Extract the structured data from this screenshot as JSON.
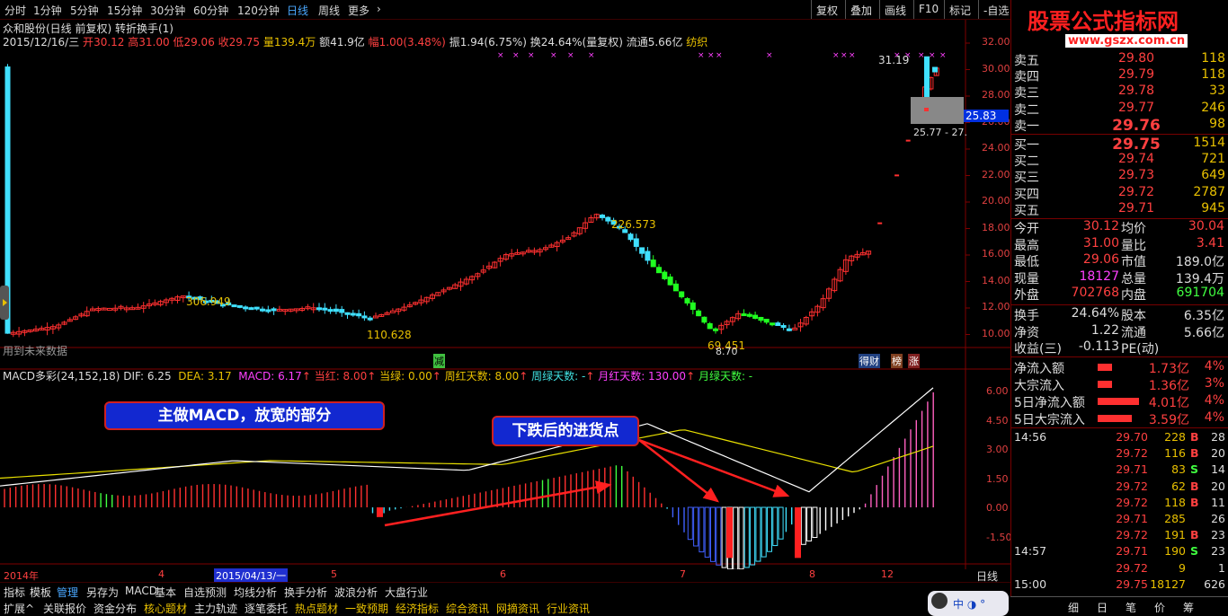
{
  "toolbar": {
    "periods": [
      "分时",
      "1分钟",
      "5分钟",
      "15分钟",
      "30分钟",
      "60分钟",
      "120分钟",
      "日线",
      "周线",
      "更多"
    ],
    "right": [
      "复权",
      "叠加",
      "画线",
      "F10",
      "标记",
      "-自选"
    ]
  },
  "header": {
    "title_line": "众和股份(日线 前复权) 转折换手(1)",
    "date": "2015/12/16/三",
    "open_lbl": "开",
    "open": "30.12",
    "high_lbl": "高",
    "high": "31.00",
    "low_lbl": "低",
    "low": "29.06",
    "close_lbl": "收",
    "close": "29.75",
    "vol_lbl": "量",
    "vol": "139.4万",
    "amt_lbl": "额",
    "amt": "41.9亿",
    "chg_lbl": "幅",
    "chg": "1.00(3.48%)",
    "amp_lbl": "振",
    "amp": "1.94(6.75%)",
    "turn_lbl": "换",
    "turn": "24.64%(量复权)",
    "float_lbl": "流通",
    "float": "5.66亿",
    "industry": "纺织"
  },
  "price_axis": [
    "32.00",
    "30.00",
    "28.00",
    "26.00",
    "24.00",
    "22.00",
    "20.00",
    "18.00",
    "16.00",
    "14.00",
    "12.00",
    "10.00"
  ],
  "price_axis_highlight": "25.83",
  "labels": {
    "hi1": "31.19",
    "range": "25.77 - 27.",
    "p1": "306.949",
    "p2": "110.628",
    "p3": "226.573",
    "p4": "69.451",
    "p5": "8.70",
    "future": "用到未来数据",
    "mark_jian": "减",
    "mark_caifu": "得财",
    "mark_bang": "榜",
    "mark_zhang": "涨"
  },
  "macd": {
    "name": "MACD多彩(24,152,18)",
    "dif": "DIF: 6.25",
    "dea": "DEA: 3.17",
    "macd": "MACD: 6.17",
    "dang_hong": "当红: 8.00",
    "dang_lv": "当绿: 0.00",
    "zhou_hong": "周红天数: 8.00",
    "zhou_lv": "周绿天数: -",
    "yue_hong": "月红天数: 130.00",
    "yue_lv": "月绿天数: -",
    "axis": [
      "6.00",
      "4.50",
      "3.00",
      "1.50",
      "0.00",
      "-1.50"
    ]
  },
  "annotations": {
    "box1": "主做MACD，放宽的部分",
    "box2": "下跌后的进货点"
  },
  "date_axis": [
    "2014年",
    "4",
    "2015/04/13/一",
    "5",
    "6",
    "7",
    "8",
    "12"
  ],
  "period_tag": "日线",
  "bottom_tabs1": [
    "指标",
    "模板",
    "管理",
    "另存为",
    "MACD",
    "基本",
    "自选预测",
    "均线分析",
    "换手分析",
    "波浪分析",
    "大盘行业"
  ],
  "bottom_tabs2": [
    "扩展^",
    "关联报价",
    "资金分布",
    "核心题材",
    "主力轨迹",
    "逐笔委托",
    "热点题材",
    "一致预期",
    "经济指标",
    "综合资讯",
    "网摘资讯",
    "行业资讯"
  ],
  "watermark": {
    "cn": "股票公式指标网",
    "url": "www.gszx.com.cn"
  },
  "quote": {
    "sells": [
      {
        "lbl": "卖五",
        "px": "29.80",
        "vol": "118"
      },
      {
        "lbl": "卖四",
        "px": "29.79",
        "vol": "118"
      },
      {
        "lbl": "卖三",
        "px": "29.78",
        "vol": "33"
      },
      {
        "lbl": "卖二",
        "px": "29.77",
        "vol": "246"
      },
      {
        "lbl": "卖一",
        "px": "29.76",
        "vol": "98"
      }
    ],
    "buys": [
      {
        "lbl": "买一",
        "px": "29.75",
        "vol": "1514"
      },
      {
        "lbl": "买二",
        "px": "29.74",
        "vol": "721"
      },
      {
        "lbl": "买三",
        "px": "29.73",
        "vol": "649"
      },
      {
        "lbl": "买四",
        "px": "29.72",
        "vol": "2787"
      },
      {
        "lbl": "买五",
        "px": "29.71",
        "vol": "945"
      }
    ]
  },
  "stats": [
    {
      "l": "今开",
      "lv": "30.12",
      "lc": "red",
      "r": "均价",
      "rv": "30.04",
      "rc": "red"
    },
    {
      "l": "最高",
      "lv": "31.00",
      "lc": "red",
      "r": "量比",
      "rv": "3.41",
      "rc": "red"
    },
    {
      "l": "最低",
      "lv": "29.06",
      "lc": "red",
      "r": "市值",
      "rv": "189.0亿",
      "rc": "wht"
    },
    {
      "l": "现量",
      "lv": "18127",
      "lc": "mag",
      "r": "总量",
      "rv": "139.4万",
      "rc": "wht"
    },
    {
      "l": "外盘",
      "lv": "702768",
      "lc": "red",
      "r": "内盘",
      "rv": "691704",
      "rc": "grn"
    }
  ],
  "stats2": [
    {
      "l": "换手",
      "lv": "24.64%",
      "r": "股本",
      "rv": "6.35亿"
    },
    {
      "l": "净资",
      "lv": "1.22",
      "r": "流通",
      "rv": "5.66亿"
    },
    {
      "l": "收益(三)",
      "lv": "-0.113",
      "r": "PE(动)",
      "rv": ""
    }
  ],
  "flows": [
    {
      "l": "净流入额",
      "v": "1.73亿",
      "p": "4%"
    },
    {
      "l": "大宗流入",
      "v": "1.36亿",
      "p": "3%"
    },
    {
      "l": "5日净流入额",
      "v": "4.01亿",
      "p": "4%"
    },
    {
      "l": "5日大宗流入",
      "v": "3.59亿",
      "p": "4%"
    }
  ],
  "ticks": [
    {
      "t": "14:56",
      "p": "29.70",
      "v": "228",
      "d": "B",
      "n": "28"
    },
    {
      "t": "",
      "p": "29.72",
      "v": "116",
      "d": "B",
      "n": "20"
    },
    {
      "t": "",
      "p": "29.71",
      "v": "83",
      "d": "S",
      "n": "14"
    },
    {
      "t": "",
      "p": "29.72",
      "v": "62",
      "d": "B",
      "n": "20"
    },
    {
      "t": "",
      "p": "29.72",
      "v": "118",
      "d": "B",
      "n": "11"
    },
    {
      "t": "",
      "p": "29.71",
      "v": "285",
      "d": "",
      "n": "26"
    },
    {
      "t": "",
      "p": "29.72",
      "v": "191",
      "d": "B",
      "n": "23"
    },
    {
      "t": "14:57",
      "p": "29.71",
      "v": "190",
      "d": "S",
      "n": "23"
    },
    {
      "t": "",
      "p": "29.72",
      "v": "9",
      "d": "",
      "n": "1"
    },
    {
      "t": "15:00",
      "p": "29.75",
      "v": "18127",
      "d": "",
      "n": "626"
    }
  ],
  "panel_tabs": [
    "细",
    "日",
    "笔",
    "价",
    "筹"
  ]
}
